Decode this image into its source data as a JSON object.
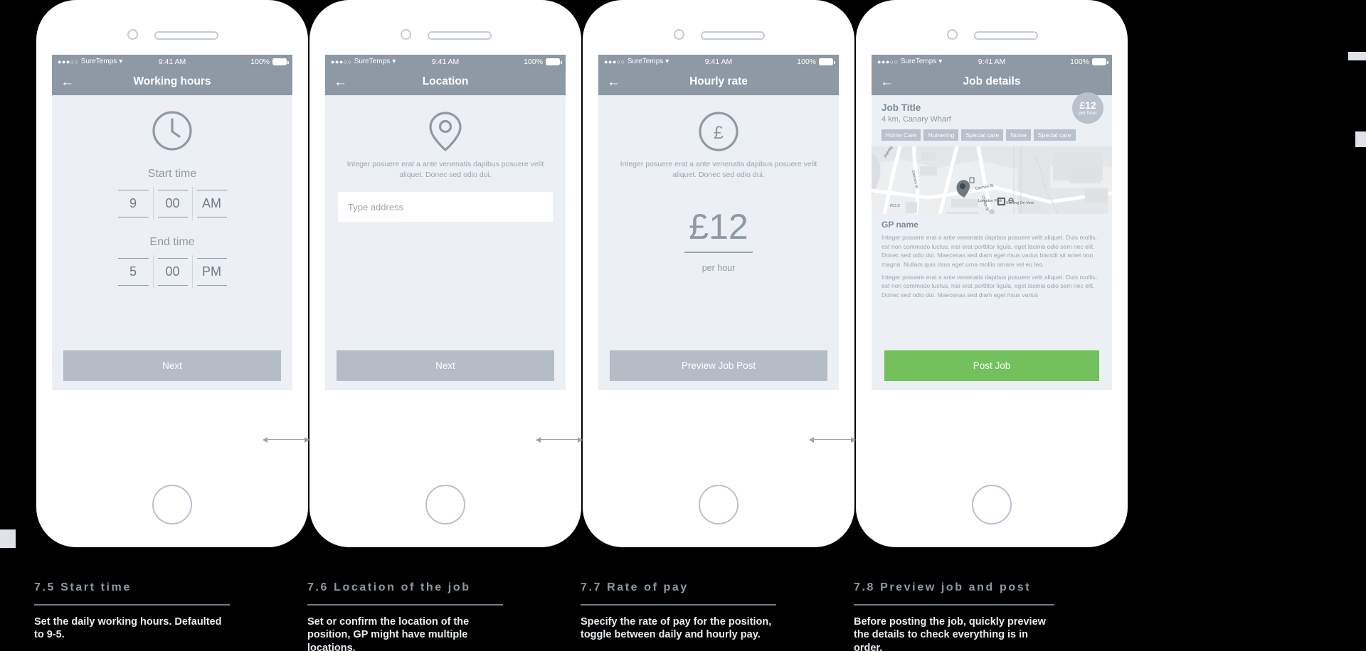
{
  "status_bar": {
    "signal_dots": "●●●○○",
    "carrier": "SureTemps",
    "wifi_icon": "wifi-icon",
    "time": "9:41 AM",
    "battery_percent": "100%"
  },
  "colors": {
    "nav_bar": "#8d99a4",
    "screen_bg": "#eceff4",
    "cta_grey": "#b4bcc5",
    "cta_green": "#72c15c",
    "tag_grey": "#b7c2cc",
    "caption_text": "#e8edf1"
  },
  "screens": [
    {
      "id": "working-hours",
      "nav_title": "Working hours",
      "back_icon": "arrow-left-icon",
      "hero_icon": "clock-icon",
      "start_label": "Start time",
      "end_label": "End time",
      "start_time": {
        "hour": "9",
        "minute": "00",
        "meridiem": "AM"
      },
      "end_time": {
        "hour": "5",
        "minute": "00",
        "meridiem": "PM"
      },
      "cta_label": "Next"
    },
    {
      "id": "location",
      "nav_title": "Location",
      "back_icon": "arrow-left-icon",
      "hero_icon": "map-pin-icon",
      "description": "Integer posuere erat a ante venenatis dapibus posuere velit aliquet. Donec sed odio dui.",
      "address_placeholder": "Type address",
      "address_value": "",
      "cta_label": "Next"
    },
    {
      "id": "hourly-rate",
      "nav_title": "Hourly rate",
      "back_icon": "arrow-left-icon",
      "hero_icon": "pound-circle-icon",
      "description": "Integer posuere erat a ante venenatis dapibus posuere velit aliquet. Donec sed odio dui.",
      "rate_amount": "£12",
      "rate_unit": "per hour",
      "cta_label": "Preview Job Post"
    },
    {
      "id": "job-details",
      "nav_title": "Job details",
      "back_icon": "arrow-left-icon",
      "job_title": "Job Title",
      "job_location": "4 km, Canary Wharf",
      "badge_amount": "£12",
      "badge_unit": "per hour",
      "tags": [
        "Home Care",
        "Nursering",
        "Special care",
        "Nurse",
        "Special care"
      ],
      "map": {
        "pin_icon": "map-pin-icon",
        "labels": [
          "Langdon Park",
          "Sterling De Vere",
          "Carmen St",
          "Chrisp St",
          "Carron St",
          "P.O.S",
          "Hobday"
        ]
      },
      "gp_name": "GP name",
      "paragraphs": [
        "Integer posuere erat a ante venenatis dapibus posuere velit aliquet. Duis mollis, est non commodo luctus, nisi erat porttitor ligula, eget lacinia odio sem nec elit. Donec sed odio dui. Maecenas sed diam eget risus varius blandit sit amet non magna. Nullam quis risus eget urna mollis ornare vel eu leo.",
        "Integer posuere erat a ante venenatis dapibus posuere velit aliquet. Duis mollis, est non commodo luctus, nisi erat porttitor ligula, eget lacinia odio sem nec elit. Donec sed odio dui. Maecenas sed diam eget risus varius"
      ],
      "cta_label": "Post Job"
    }
  ],
  "captions": [
    {
      "title": "7.5 Start time",
      "description": "Set the daily working hours. Defaulted to 9-5."
    },
    {
      "title": "7.6 Location of the job",
      "description": "Set or confirm the location of the position, GP might have multiple locations."
    },
    {
      "title": "7.7 Rate of pay",
      "description": "Specify the rate of pay for the position, toggle between daily and hourly pay."
    },
    {
      "title": "7.8 Preview job and post",
      "description": "Before posting the job, quickly preview the details to check everything is in order."
    }
  ]
}
